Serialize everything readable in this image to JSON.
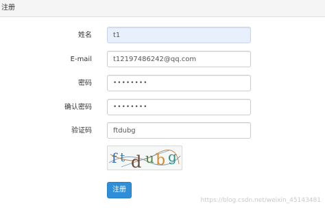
{
  "panel": {
    "title": "注册"
  },
  "form": {
    "name": {
      "label": "姓名",
      "value": "t1"
    },
    "email": {
      "label": "E-mail",
      "value": "t12197486242@qq.com"
    },
    "password": {
      "label": "密码",
      "value": "••••••••"
    },
    "confirm": {
      "label": "确认密码",
      "value": "••••••••"
    },
    "code": {
      "label": "验证码",
      "value": "ftdubg"
    },
    "captcha_text": "ftdubg",
    "submit_label": "注册"
  },
  "watermark": "https://blog.csdn.net/weixin_45143481",
  "colors": {
    "primary": "#2e8fd8",
    "autofill_bg": "#e8f0fe",
    "heading_bg": "#f5f5f5"
  }
}
